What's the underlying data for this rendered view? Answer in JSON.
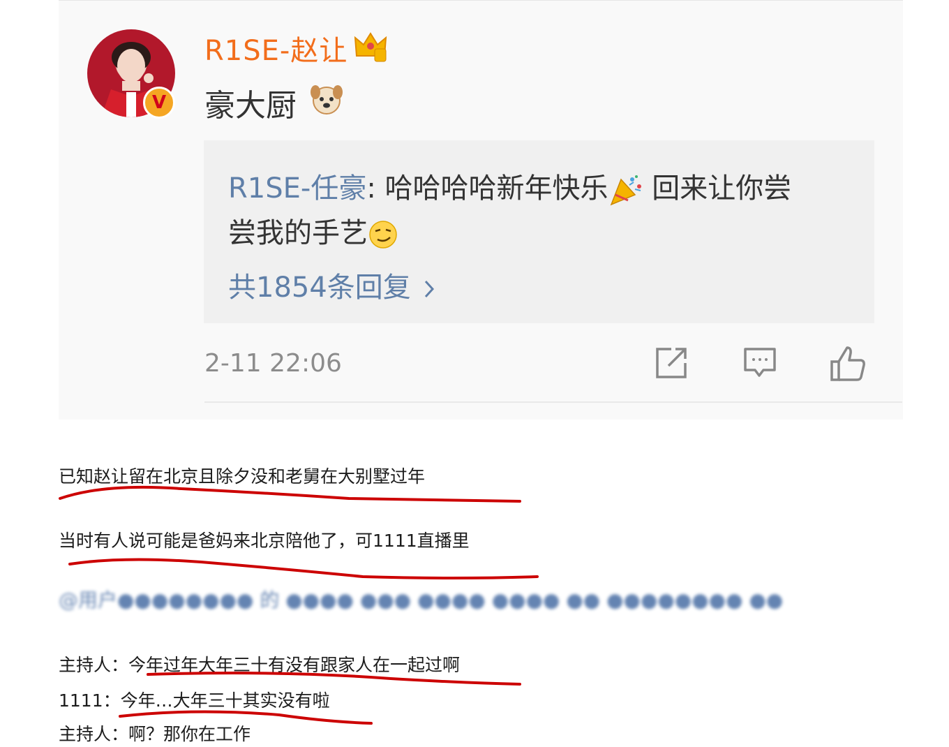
{
  "post": {
    "username": "R1SE-赵让",
    "text": "豪大厨",
    "verified_badge": "V",
    "quoted_comment": {
      "author": "R1SE-任豪",
      "separator": ":",
      "line1_text": " 哈哈哈哈新年快乐",
      "line1_tail": " 回来让你尝",
      "line2_text": "尝我的手艺"
    },
    "replies_link": "共1854条回复",
    "timestamp": "2-11 22:06",
    "icons": [
      "crown-icon",
      "dog-emoji-icon",
      "party-popper-icon",
      "smirk-emoji-icon",
      "chevron-right-icon",
      "share-icon",
      "comment-icon",
      "like-icon"
    ],
    "accent_colors": {
      "username": "#f26d1b",
      "link": "#5f7fa8",
      "underline": "#cc0000"
    }
  },
  "notes": {
    "line1": "已知赵让留在北京且除夕没和老舅在大别墅过年",
    "line2": "当时有人说可能是爸妈来北京陪他了，可1111直播里",
    "line3": "主持人：今年过年大年三十有没有跟家人在一起过啊",
    "line4": "1111：今年…大年三十其实没有啦",
    "line5": "主持人：啊？那你在工作"
  }
}
